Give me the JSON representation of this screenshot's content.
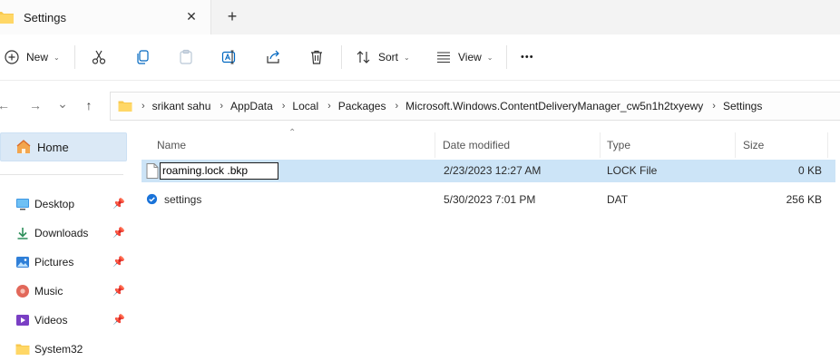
{
  "tab": {
    "title": "Settings",
    "close": "✕",
    "new_tab": "+"
  },
  "toolbar": {
    "new_label": "New",
    "sort_label": "Sort",
    "view_label": "View",
    "more": "•••"
  },
  "nav": {
    "back": "←",
    "forward": "→",
    "recent": "⌄",
    "up": "↑"
  },
  "breadcrumb": [
    "srikant sahu",
    "AppData",
    "Local",
    "Packages",
    "Microsoft.Windows.ContentDeliveryManager_cw5n1h2txyewy",
    "Settings"
  ],
  "sidebar": {
    "home": "Home",
    "items": [
      {
        "label": "Desktop",
        "icon": "desktop-icon",
        "pinned": true
      },
      {
        "label": "Downloads",
        "icon": "download-icon",
        "pinned": true
      },
      {
        "label": "Pictures",
        "icon": "pictures-icon",
        "pinned": true
      },
      {
        "label": "Music",
        "icon": "music-icon",
        "pinned": true
      },
      {
        "label": "Videos",
        "icon": "videos-icon",
        "pinned": true
      },
      {
        "label": "System32",
        "icon": "folder-icon",
        "pinned": false
      }
    ]
  },
  "columns": {
    "name": "Name",
    "date": "Date modified",
    "type": "Type",
    "size": "Size"
  },
  "files": [
    {
      "name": "roaming.lock .bkp",
      "date": "2/23/2023 12:27 AM",
      "type": "LOCK File",
      "size": "0 KB",
      "selected": true,
      "renaming": true
    },
    {
      "name": "settings",
      "date": "5/30/2023 7:01 PM",
      "type": "DAT",
      "size": "256 KB",
      "selected": false,
      "renaming": false
    }
  ],
  "colors": {
    "accent": "#0067c0",
    "selection": "#cce4f7",
    "home_bg": "#dbe9f6",
    "folder": "#f8c950"
  }
}
